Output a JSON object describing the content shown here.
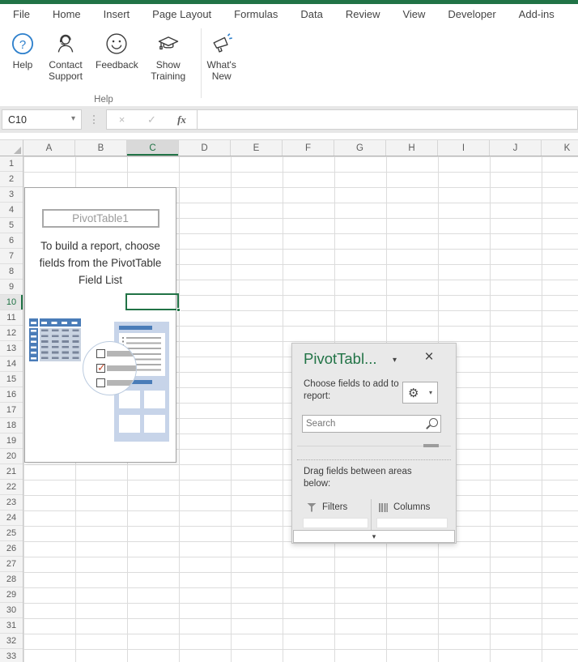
{
  "theme": {
    "accent": "#217346",
    "help_blue": "#2E80CC",
    "graphic_blue": "#4A7CB8",
    "panel_blue": "#C7D4E9",
    "check_red": "#C54A2C",
    "pane_bg": "#E9E9E9"
  },
  "ribbon": {
    "tabs": [
      "File",
      "Home",
      "Insert",
      "Page Layout",
      "Formulas",
      "Data",
      "Review",
      "View",
      "Developer",
      "Add-ins"
    ],
    "group_label": "Help",
    "buttons": [
      {
        "label": "Help",
        "icon": "help-icon"
      },
      {
        "label": "Contact Support",
        "icon": "contact-support-icon"
      },
      {
        "label": "Feedback",
        "icon": "feedback-icon"
      },
      {
        "label": "Show Training",
        "icon": "show-training-icon"
      },
      {
        "label": "What's New",
        "icon": "whats-new-icon"
      }
    ]
  },
  "formula_bar": {
    "name_box": "C10",
    "fx_label": "fx",
    "value": "",
    "cancel_glyph": "×",
    "enter_glyph": "✓",
    "dropdown_glyph": "▾"
  },
  "grid": {
    "columns": [
      "A",
      "B",
      "C",
      "D",
      "E",
      "F",
      "G",
      "H",
      "I",
      "J",
      "K"
    ],
    "rows": [
      "1",
      "2",
      "3",
      "4",
      "5",
      "6",
      "7",
      "8",
      "9",
      "10",
      "11",
      "12",
      "13",
      "14",
      "15",
      "16",
      "17",
      "18",
      "19",
      "20",
      "21",
      "22",
      "23",
      "24",
      "25",
      "26",
      "27",
      "28",
      "29",
      "30",
      "31",
      "32",
      "33"
    ],
    "selected_cell": "C10",
    "selected_column": "C",
    "selected_row": "10"
  },
  "pivot_placeholder": {
    "name": "PivotTable1",
    "message": "To build a report, choose fields from the PivotTable Field List"
  },
  "field_pane": {
    "title": "PivotTabl...",
    "title_caret": "▾",
    "close_glyph": "×",
    "subtitle": "Choose fields to add to report:",
    "gear_glyph": "⚙",
    "gear_caret": "▾",
    "search_placeholder": "Search",
    "drag_hint": "Drag fields between areas below:",
    "areas": [
      {
        "label": "Filters"
      },
      {
        "label": "Columns"
      }
    ],
    "bottom_caret": "▾"
  }
}
